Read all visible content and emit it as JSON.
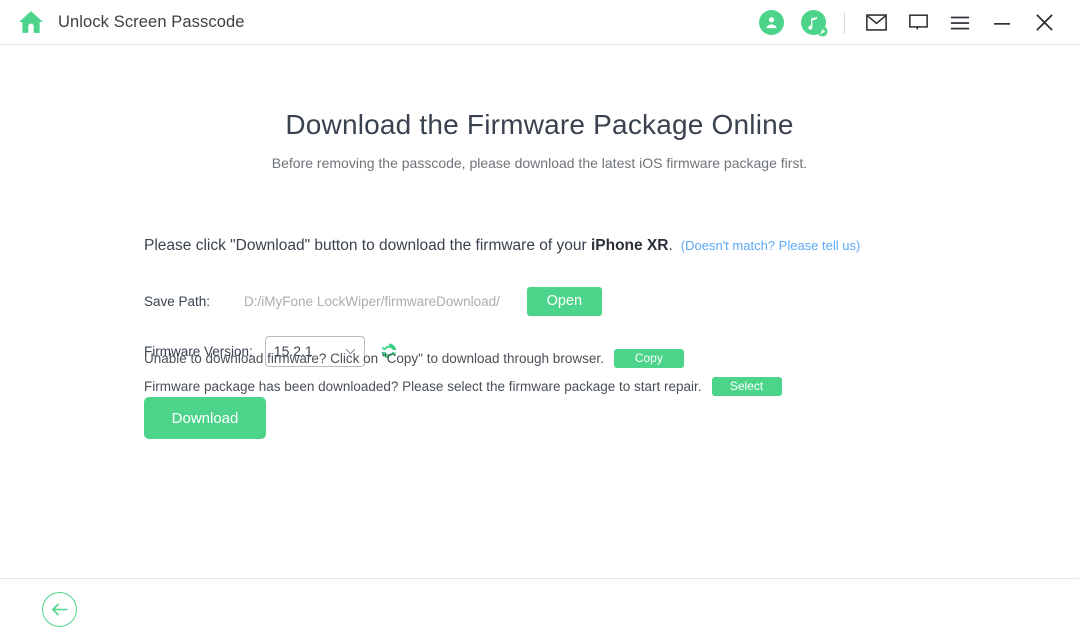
{
  "titlebar": {
    "app_title": "Unlock Screen Passcode",
    "icons": {
      "home": "home-icon",
      "account": "account-circle-icon",
      "tools": "music-tools-icon",
      "mail": "mail-icon",
      "feedback": "feedback-icon",
      "menu": "hamburger-menu-icon",
      "minimize": "minimize-icon",
      "close": "close-icon"
    }
  },
  "main": {
    "heading": "Download the Firmware Package Online",
    "subheading": "Before removing the passcode, please download the latest iOS firmware package first.",
    "instruction_prefix": "Please click \"Download\" button to download the firmware of your ",
    "device_name": "iPhone XR",
    "instruction_suffix": ".",
    "mismatch_link": "(Doesn't match? Please tell us)",
    "save_path_label": "Save Path:",
    "save_path_value": "D:/iMyFone LockWiper/firmwareDownload/",
    "open_button": "Open",
    "firmware_version_label": "Firmware Version:",
    "firmware_version_value": "15.2.1",
    "firmware_version_options": [
      "15.2.1"
    ],
    "refresh_icon": "refresh-icon",
    "download_button": "Download"
  },
  "footer_notes": {
    "copy_text": "Unable to download firmware? Click on \"Copy\" to download through browser.",
    "copy_button": "Copy",
    "select_text": "Firmware package has been downloaded? Please select the firmware package to start repair.",
    "select_button": "Select"
  },
  "footer": {
    "back_icon": "arrow-left-icon"
  },
  "colors": {
    "accent_green": "#4cd58a",
    "link_blue": "#5aa9f7",
    "text_dark": "#3a4250",
    "text_muted": "#a9aeb3"
  }
}
